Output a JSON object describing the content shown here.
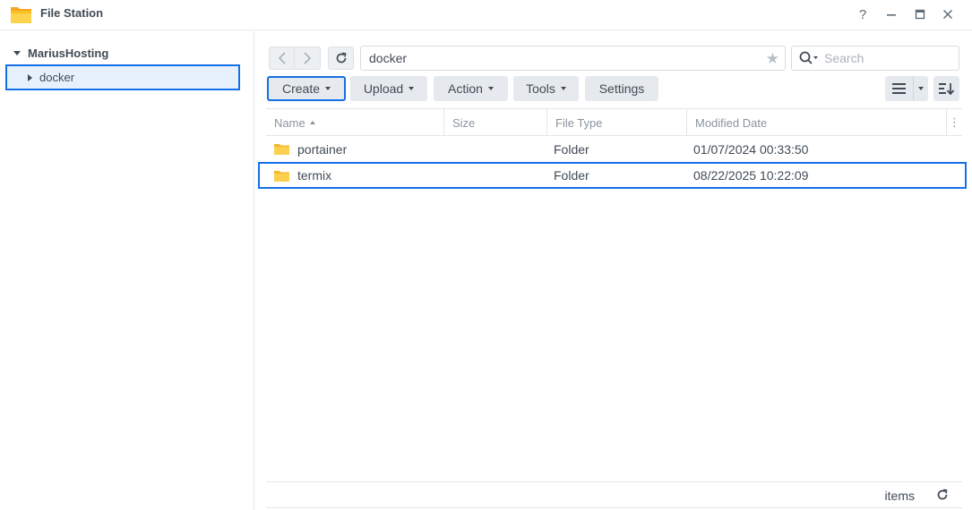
{
  "window": {
    "title": "File Station",
    "icon": "folder-app-icon",
    "controls": {
      "help": "?",
      "minimize": "—",
      "maximize": "▢",
      "close": "✕"
    }
  },
  "sidebar": {
    "root_label": "MariusHosting",
    "items": [
      {
        "label": "docker",
        "selected": true
      }
    ]
  },
  "toolbar": {
    "path": "docker",
    "search_placeholder": "Search",
    "buttons": {
      "create": "Create",
      "upload": "Upload",
      "action": "Action",
      "tools": "Tools",
      "settings": "Settings"
    }
  },
  "table": {
    "columns": {
      "name": "Name",
      "size": "Size",
      "type": "File Type",
      "modified": "Modified Date"
    },
    "rows": [
      {
        "name": "portainer",
        "size": "",
        "type": "Folder",
        "modified": "01/07/2024 00:33:50"
      },
      {
        "name": "termix",
        "size": "",
        "type": "Folder",
        "modified": "08/22/2025 10:22:09",
        "highlighted": true
      }
    ]
  },
  "footer": {
    "items_label": "items"
  },
  "colors": {
    "accent": "#1470e6",
    "folder": "#f7c23a",
    "text": "#414b55",
    "muted": "#8b949e"
  }
}
